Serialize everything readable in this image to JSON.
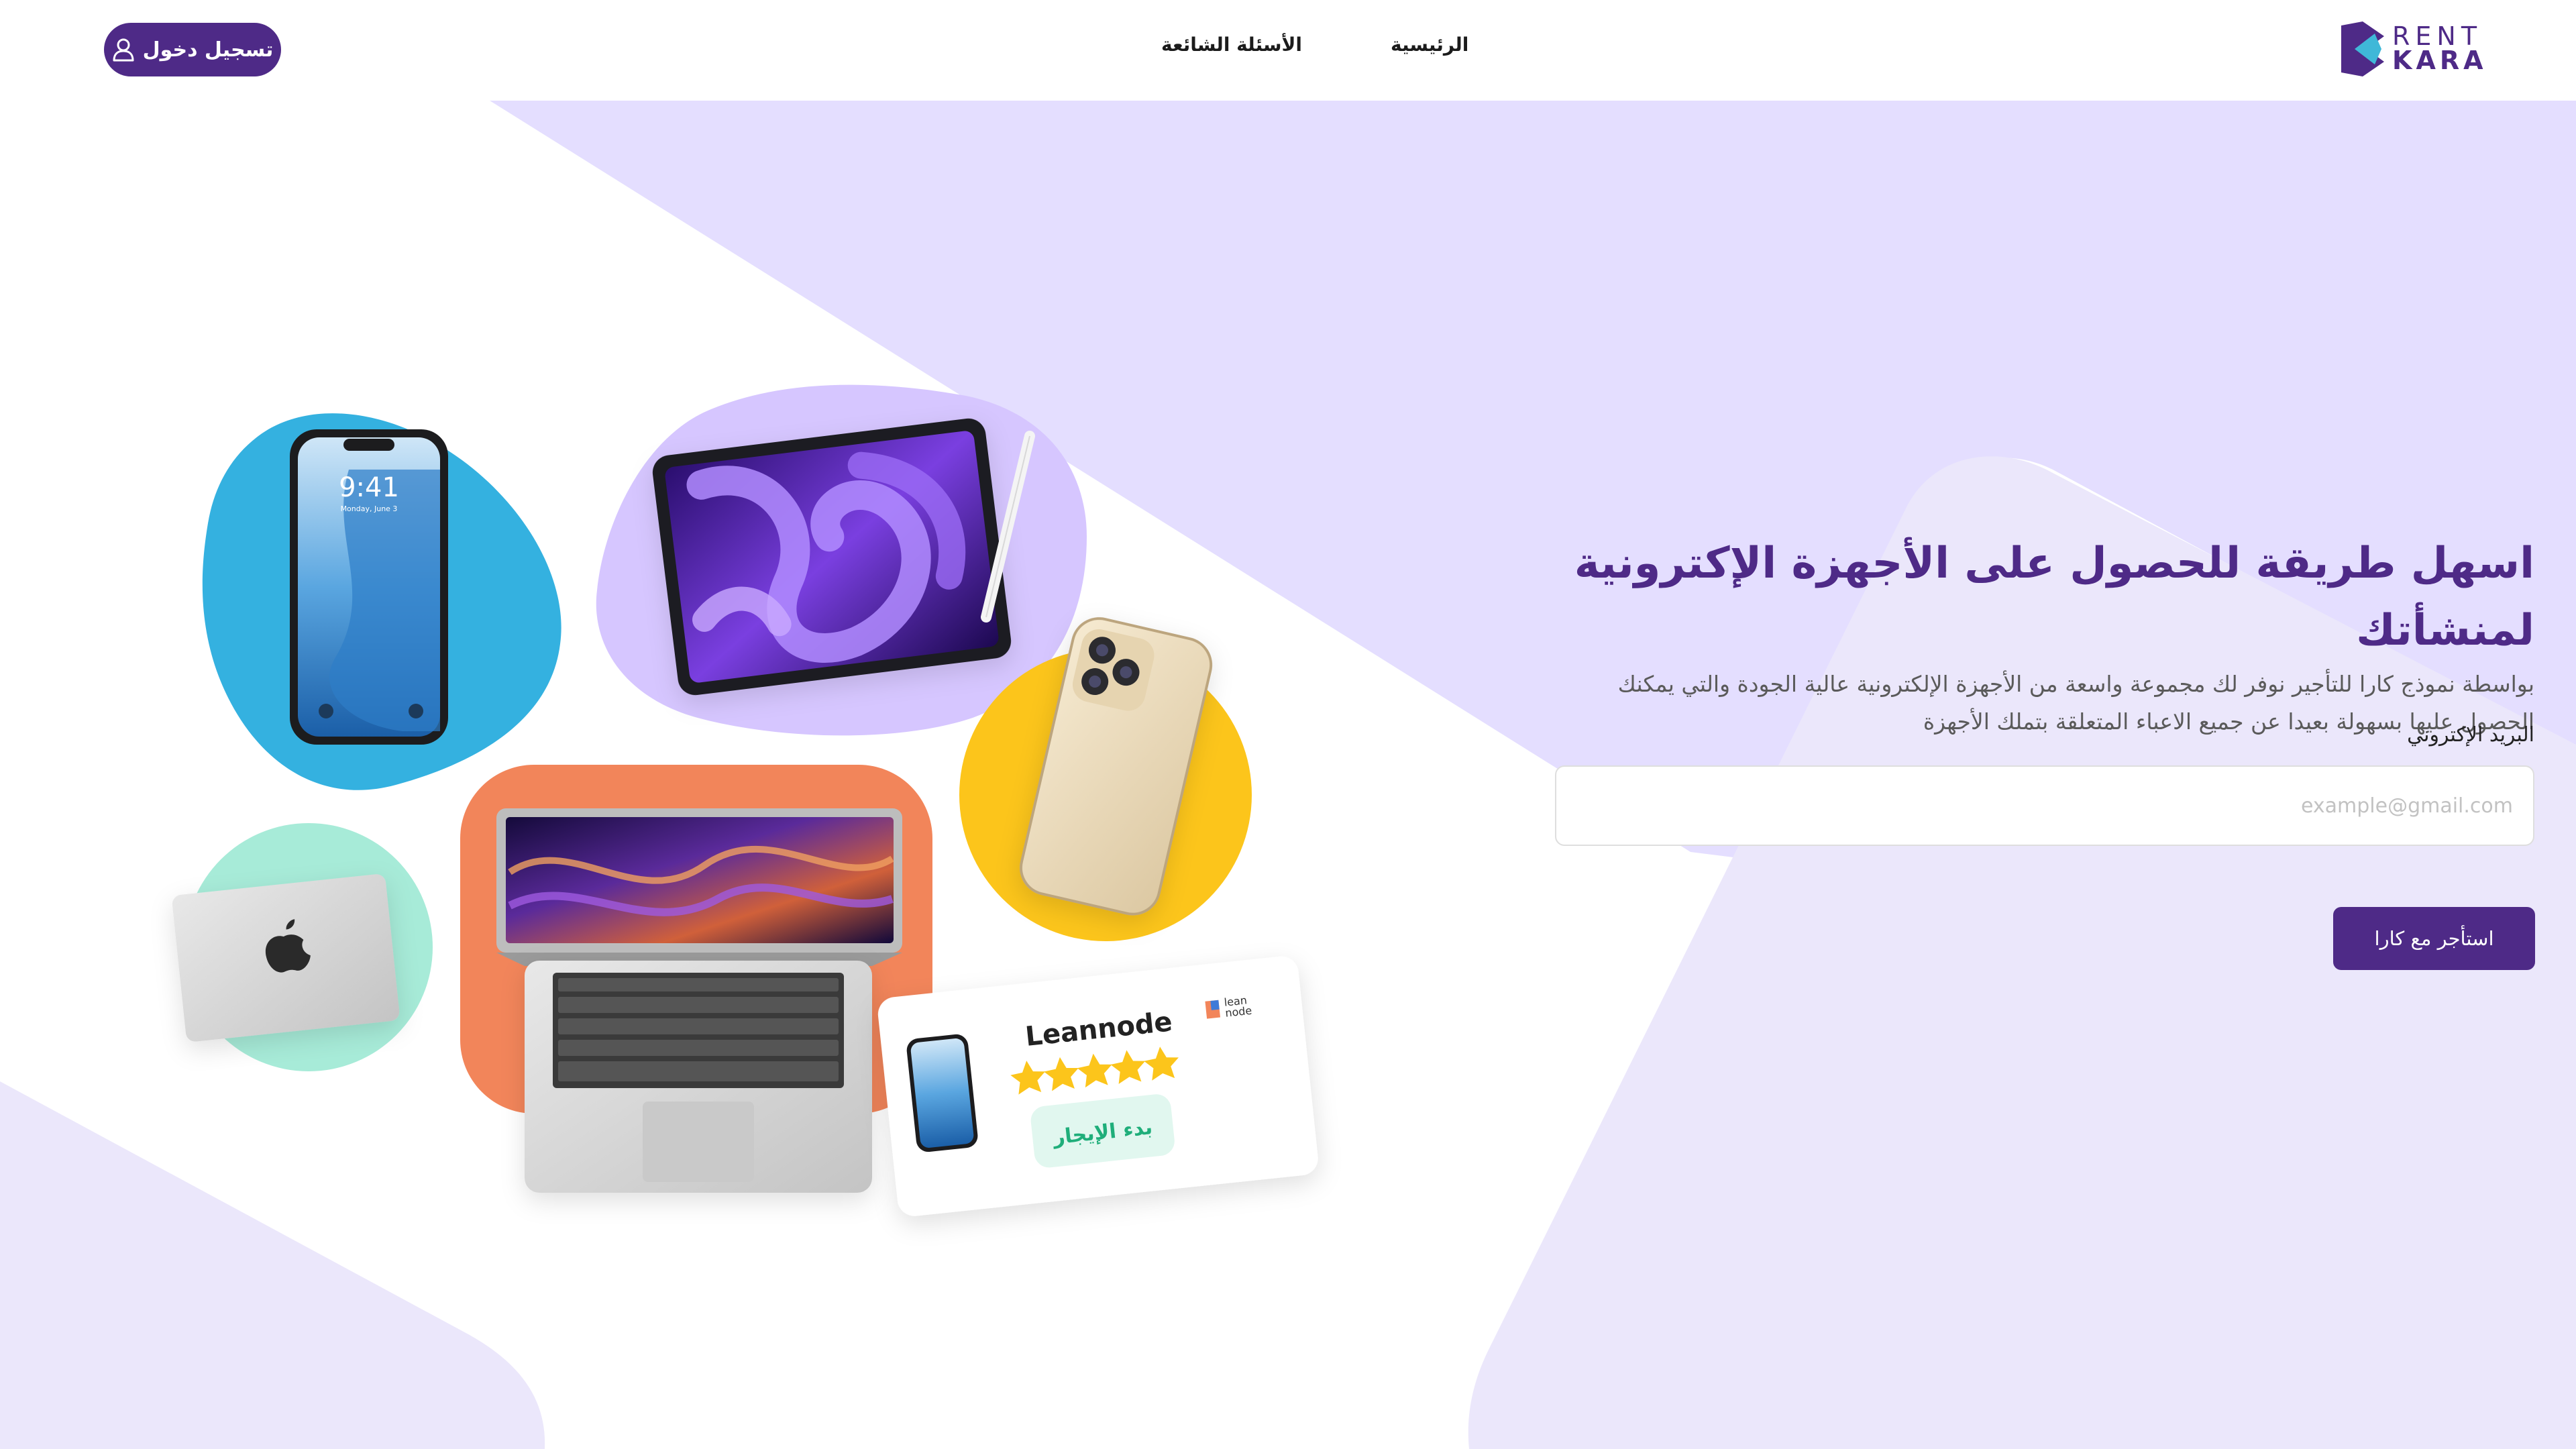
{
  "brand": {
    "logo_line1": "RENT",
    "logo_line2": "KARA",
    "primary_color": "#4e2a87",
    "logo_accent": "#3fb8d8"
  },
  "header": {
    "login_label": "تسجيل دخول",
    "login_icon": "user-icon",
    "nav": {
      "home": "الرئيسية",
      "faq": "الأسئلة الشائعة"
    }
  },
  "hero": {
    "title": "اسهل طريقة للحصول على الأجهزة الإكترونية لمنشأتك",
    "description_line1": "بواسطة نموذج كارا للتأجير نوفر لك مجموعة واسعة من الأجهزة الإلكترونية عالية الجودة والتي يمكنك",
    "description_line2": "الحصول عليها بسهولة بعيدا عن جميع الاعباء المتعلقة بتملك الأجهزة"
  },
  "form": {
    "email_label": "البريد الإكتروني",
    "email_placeholder": "example@gmail.com",
    "email_value": "",
    "submit_label": "استأجر مع كارا"
  },
  "illustration": {
    "phone_time": "9:41",
    "phone_date": "Monday, June 3",
    "review_card": {
      "name": "Leannode",
      "brand_line1": "lean",
      "brand_line2": "node",
      "rating": 5,
      "rating_max": 5,
      "button_label": "بدء الإيجار"
    }
  }
}
